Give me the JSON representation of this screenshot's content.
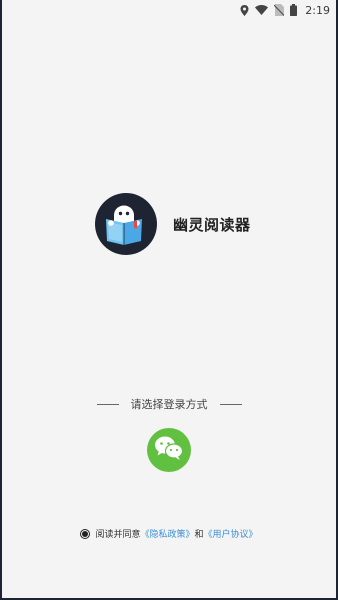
{
  "status_bar": {
    "time": "2:19",
    "icons": [
      "location-icon",
      "wifi-icon",
      "no-sim-icon",
      "battery-icon"
    ]
  },
  "app": {
    "name": "幽灵阅读器",
    "logo_icon": "ghost-reading-book-icon"
  },
  "login": {
    "prompt": "请选择登录方式",
    "wechat_icon": "wechat-icon",
    "wechat_color": "#62c041"
  },
  "agreement": {
    "prefix": "阅读并同意",
    "privacy_link": "《隐私政策》",
    "conjunction": "和",
    "terms_link": "《用户协议》",
    "link_color": "#3a8fd6"
  }
}
